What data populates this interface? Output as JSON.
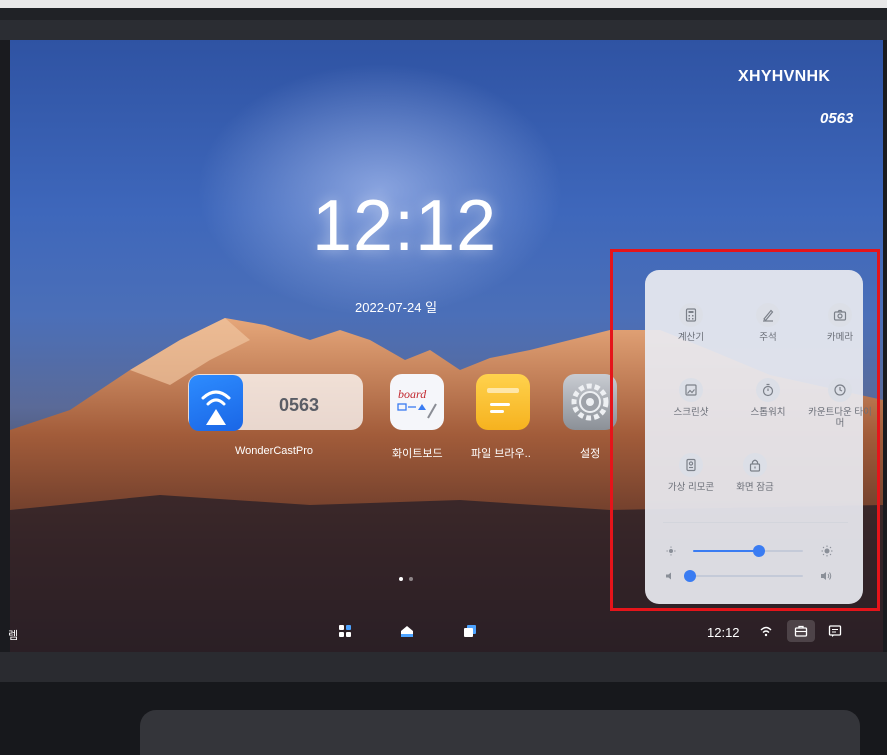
{
  "device": {
    "name": "XHYHVNHK",
    "code": "0563"
  },
  "home": {
    "time": "12:12",
    "date": "2022-07-24 일"
  },
  "apps": {
    "wondercast": {
      "label": "WonderCastPro",
      "code": "0563"
    },
    "whiteboard": {
      "label": "화이트보드",
      "logo_text": "board"
    },
    "file_browser": {
      "label": "파일 브라우.."
    },
    "settings": {
      "label": "설정"
    }
  },
  "taskbar": {
    "left_label": "렘",
    "time": "12:12"
  },
  "quick_panel": {
    "buttons": [
      {
        "label": "계산기",
        "icon": "calculator-icon"
      },
      {
        "label": "주석",
        "icon": "pen-icon"
      },
      {
        "label": "카메라",
        "icon": "camera-icon"
      },
      {
        "label": "스크린샷",
        "icon": "screenshot-icon"
      },
      {
        "label": "스톱워치",
        "icon": "stopwatch-icon"
      },
      {
        "label": "카운트다운 타이머",
        "icon": "countdown-timer-icon"
      },
      {
        "label": "가상 리모콘",
        "icon": "remote-icon"
      },
      {
        "label": "화면 잠금",
        "icon": "lock-icon"
      }
    ],
    "brightness_level": 0.6,
    "volume_level": 0.0
  },
  "colors": {
    "accent": "#3a7cf2",
    "highlight": "#e5141a",
    "wondercast": "#1a66e6"
  }
}
